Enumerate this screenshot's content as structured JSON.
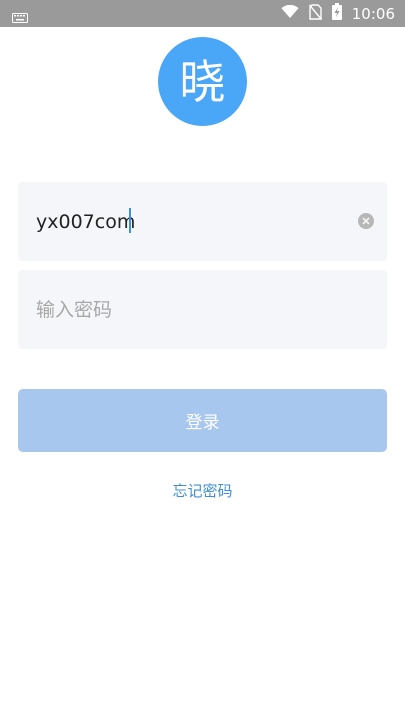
{
  "status_bar": {
    "time": "10:06",
    "icons": [
      "keyboard-icon",
      "wifi-icon",
      "no-sim-icon",
      "battery-charging-icon"
    ]
  },
  "logo": {
    "text": "晓",
    "color": "#4aa6f7"
  },
  "account_field": {
    "value": "yx007com",
    "clear_icon": "clear-icon"
  },
  "password_field": {
    "value": "",
    "placeholder": "输入密码"
  },
  "login_button": {
    "label": "登录",
    "color": "#a8c7ee"
  },
  "forgot_link": {
    "label": "忘记密码",
    "color": "#3f8fd6"
  }
}
